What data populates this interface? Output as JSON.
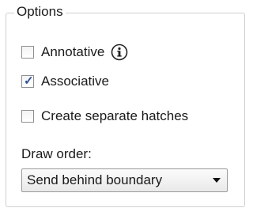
{
  "group": {
    "title": "Options"
  },
  "options": [
    {
      "label": "Annotative",
      "checked": false,
      "info_icon": "info-icon"
    },
    {
      "label": "Associative",
      "checked": true
    },
    {
      "label": "Create separate hatches",
      "checked": false
    }
  ],
  "draw_order": {
    "label": "Draw order:",
    "selected": "Send behind boundary",
    "arrow_icon": "dropdown-arrow-icon"
  }
}
